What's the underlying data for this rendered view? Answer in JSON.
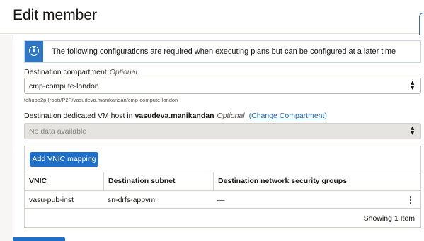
{
  "page": {
    "title": "Edit member"
  },
  "info": {
    "message": "The following configurations are required when executing plans but can be configured at a later time"
  },
  "compartment": {
    "label": "Destination compartment",
    "optional": "Optional",
    "value": "cmp-compute-london",
    "path": "tehubp2p (root)/P2P/vasudeva.manikandan/cmp-compute-london"
  },
  "vm_host": {
    "label_prefix": "Destination dedicated VM host in",
    "compartment_name": "vasudeva.manikandan",
    "optional": "Optional",
    "change_link": "(Change Compartment)",
    "value": "No data available"
  },
  "vnic": {
    "add_button": "Add VNIC mapping",
    "columns": [
      "VNIC",
      "Destination subnet",
      "Destination network security groups"
    ],
    "rows": [
      {
        "vnic": "vasu-pub-inst",
        "subnet": "sn-drfs-appvm",
        "nsg": "—"
      }
    ],
    "footer": "Showing 1 Item"
  },
  "icons": {
    "info": "info-icon",
    "select": "up-down-arrows-icon",
    "menu": "kebab-menu-icon"
  },
  "colors": {
    "accent": "#1f6fc9",
    "link": "#1a6ab6"
  }
}
